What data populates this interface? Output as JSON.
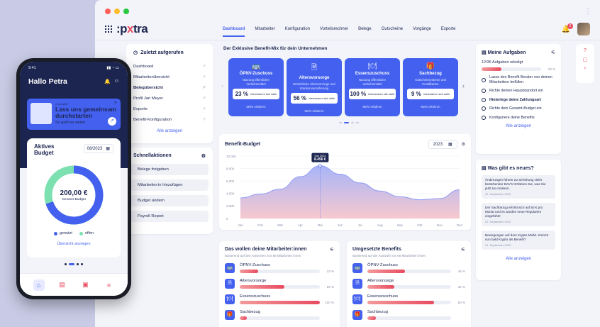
{
  "app": {
    "logo_prefix": ":p",
    "logo_x": "x",
    "logo_suffix": "tra",
    "bell_badge": "2"
  },
  "nav": [
    "Dashboard",
    "Mitarbeiter",
    "Konfiguration",
    "Vorteilsrechner",
    "Belege",
    "Gutscheine",
    "Vorgänge",
    "Exporte"
  ],
  "recent": {
    "title": "Zuletzt aufgerufen",
    "items": [
      "Dashboard",
      "Mitarbeiterübersicht",
      "Belegübersicht",
      "Profil Jan Meyer",
      "Exporte",
      "Benefit-Konfiguration"
    ],
    "show_all": "Alle anzeigen"
  },
  "quick": {
    "title": "Schnellaktionen",
    "items": [
      "Belege freigeben",
      "Mitarbeiter:in hinzufügen",
      "Budget ändern",
      "Payroll Report"
    ]
  },
  "mix": {
    "title": "Der Exklusive Benefit-Mix für dein Unternehmen",
    "cards": [
      {
        "name": "ÖPNV-Zuschuss",
        "desc": "Nutzung öffentlicher Verkehrsmittel",
        "pct": "23 %",
        "stat_label": "Interessieren sich dafür",
        "more": "Mehr erfahren",
        "icon": "🚌"
      },
      {
        "name": "Altersvorsorge",
        "desc": "Betriebliche Altersvorsorge und Krankenversicherung",
        "pct": "56 %",
        "stat_label": "Interessieren sich dafür",
        "more": "Mehr erfahren",
        "icon": "🗎"
      },
      {
        "name": "Essenszuschuss",
        "desc": "Nutzung öffentlicher Verkehrsmittel",
        "pct": "100 %",
        "stat_label": "Interessieren sich dafür",
        "more": "Mehr erfahren",
        "icon": "🍽"
      },
      {
        "name": "Sachbezug",
        "desc": "Gutscheinsysteme und Kreditkarten",
        "pct": "9 %",
        "stat_label": "Interessieren sich dafür",
        "more": "Mehr erfahren",
        "icon": "🎁"
      }
    ]
  },
  "budget": {
    "title": "Benefit-Budget",
    "year": "2023"
  },
  "chart_data": {
    "type": "area",
    "title": "Benefit-Budget",
    "categories": [
      "Jan",
      "Feb",
      "Mär",
      "Apr",
      "Mai",
      "Jun",
      "Jul",
      "Aug",
      "Sep",
      "Okt",
      "Nov",
      "Dez"
    ],
    "values": [
      3300,
      3900,
      4700,
      6700,
      8456,
      7100,
      5700,
      4400,
      3500,
      3000,
      3200,
      4600
    ],
    "ylim": [
      0,
      10000
    ],
    "yticks": [
      "10.000",
      "8.000",
      "6.000",
      "4.000",
      "2.000",
      "0"
    ],
    "tooltip": {
      "label": "Mai 2023",
      "value": "8.456 €"
    },
    "colors": {
      "line": "#8f9bf5",
      "fill_top": "#9aa8f7",
      "fill_bottom": "#f6c3c9"
    }
  },
  "wish": {
    "title": "Das wollen deine Mitarbeiter:innen",
    "sub": "Basierend auf den Antworten von 56 Mitarbeiter:innen",
    "items": [
      {
        "name": "ÖPNV-Zuschuss",
        "pct": 0.23,
        "label": "23 %",
        "icon": "🚌"
      },
      {
        "name": "Altersvorsorge",
        "pct": 0.56,
        "label": "56 %",
        "icon": "🗎"
      },
      {
        "name": "Essenszuschuss",
        "pct": 1.0,
        "label": "100 %",
        "icon": "🍽"
      },
      {
        "name": "Sachbezug",
        "pct": 0.09,
        "label": "",
        "icon": "🎁"
      }
    ]
  },
  "impl": {
    "title": "Umgesetzte Benefits",
    "sub": "Basierend auf der Auswahl von 56 Mitarbeiter:innen",
    "items": [
      {
        "name": "ÖPNV-Zuschuss",
        "pct": 0.45,
        "label": "45 %",
        "icon": "🚌"
      },
      {
        "name": "Altersvorsorge",
        "pct": 0.32,
        "label": "32 %",
        "icon": "🗎"
      },
      {
        "name": "Essenszuschuss",
        "pct": 0.8,
        "label": "80 %",
        "icon": "🍽"
      },
      {
        "name": "Sachbezug",
        "pct": 0.1,
        "label": "",
        "icon": "🎁"
      }
    ]
  },
  "tasks": {
    "title": "Meine Aufgaben",
    "progress_text": "12/36 Aufgaben erledigt",
    "progress": 0.33,
    "progress_label": "33 %",
    "items": [
      {
        "text": "Lasse den Benefit Berater von deinen Mitarbeitern befüllen",
        "bold": false
      },
      {
        "text": "Richte deinen Hauptstandort ein",
        "bold": false
      },
      {
        "text": "Hinterlege deine Zahlungsart",
        "bold": true
      },
      {
        "text": "Richte dein Gesamt-Budget ein",
        "bold": false
      },
      {
        "text": "Konfiguriere deine Benefits",
        "bold": false
      }
    ],
    "show_all": "Alle anzeigen"
  },
  "news": {
    "title": "Was gibt es neues?",
    "items": [
      {
        "text": "Änderungen führen zur Erhöhung vieler bestehender BAV's! Erfahren Sie, was Sie jetzt tun müssen.",
        "date": "21. September 2022"
      },
      {
        "text": "Der Sachbezug erhöht sich auf 50 € pro Monat und es wurden neue Regularien eingeführt!",
        "date": "02. September 2022"
      },
      {
        "text": "Bewegungen auf dem Krypto Markt. Kommt nun bald Krypto als Benefit?",
        "date": "21. September 2022"
      }
    ],
    "show_all": "Alle anzeigen"
  },
  "phone": {
    "time": "9:41",
    "greeting": "Hallo Petra",
    "promo_tag": "Geschafft",
    "promo_head": "Lass uns gemeinsam durchstarten",
    "promo_sub": "So geht es weiter",
    "budget_title": "Aktives Budget",
    "month": "08/2023",
    "amount": "200,00 €",
    "amount_label": "Gesamt-Budget",
    "used": 0.7,
    "legend_used": "genutzt",
    "legend_open": "offen",
    "link": "Übersicht anzeigen",
    "colors": {
      "used": "#4361ee",
      "open": "#7ce0b0"
    }
  }
}
